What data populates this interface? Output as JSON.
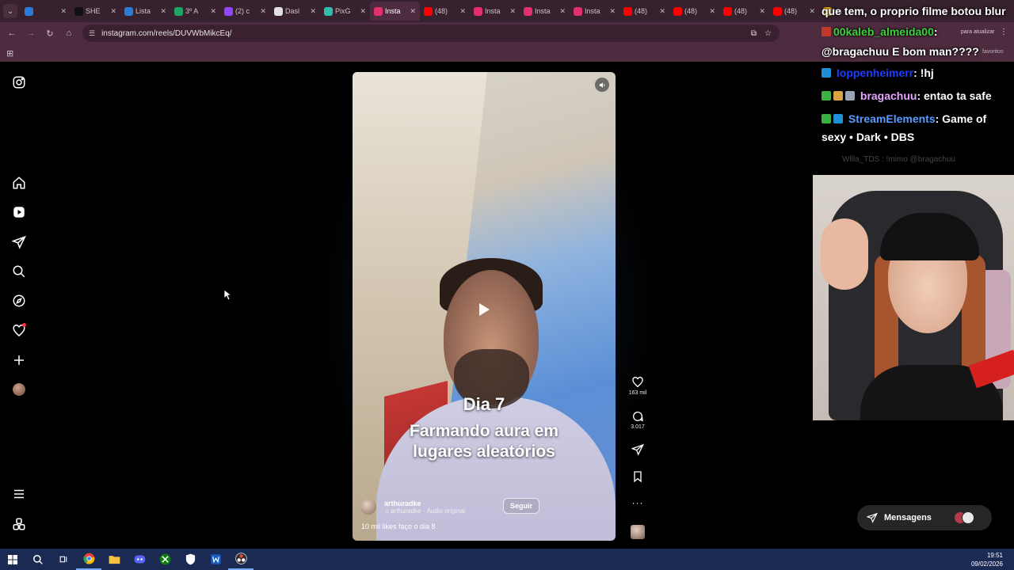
{
  "browser": {
    "tabs": [
      {
        "title": "",
        "icon": "pin-icon",
        "color": "#2b7bd8",
        "active": false
      },
      {
        "title": "SHE",
        "icon": "s-icon",
        "color": "#111111",
        "active": false
      },
      {
        "title": "Lista",
        "icon": "cloud-icon",
        "color": "#2b7bd8",
        "active": false
      },
      {
        "title": "3º A",
        "icon": "drive-icon",
        "color": "#1fa463",
        "active": false
      },
      {
        "title": "(2) c",
        "icon": "twitch-icon",
        "color": "#9146ff",
        "active": false
      },
      {
        "title": "Dasl",
        "icon": "globe-icon",
        "color": "#e0e0e0",
        "active": false
      },
      {
        "title": "PixG",
        "icon": "pix-icon",
        "color": "#32bcad",
        "active": false
      },
      {
        "title": "Insta",
        "icon": "instagram-icon",
        "color": "#e1306c",
        "active": true
      },
      {
        "title": "(48)",
        "icon": "youtube-icon",
        "color": "#ff0000",
        "active": false
      },
      {
        "title": "Insta",
        "icon": "instagram-icon",
        "color": "#e1306c",
        "active": false
      },
      {
        "title": "Insta",
        "icon": "instagram-icon",
        "color": "#e1306c",
        "active": false
      },
      {
        "title": "Insta",
        "icon": "instagram-icon",
        "color": "#e1306c",
        "active": false
      },
      {
        "title": "(48)",
        "icon": "youtube-icon",
        "color": "#ff0000",
        "active": false
      },
      {
        "title": "(48)",
        "icon": "youtube-icon",
        "color": "#ff0000",
        "active": false
      },
      {
        "title": "(48)",
        "icon": "youtube-icon",
        "color": "#ff0000",
        "active": false
      },
      {
        "title": "(48)",
        "icon": "youtube-icon",
        "color": "#ff0000",
        "active": false
      },
      {
        "title": "ca",
        "icon": "face-icon",
        "color": "#f2b600",
        "active": false
      }
    ],
    "url": "instagram.com/reels/DUVWbMikcEq/",
    "update_label": "para atualizar",
    "favorites_label": "favoritos"
  },
  "reel": {
    "caption_line1": "Dia 7",
    "caption_line2": "Farmando aura em",
    "caption_line3": "lugares aleatórios",
    "author": "arthuradke",
    "audio": "arthuradke · Áudio original",
    "follow_label": "Seguir",
    "description": "10 mil likes faço o dia 8",
    "likes": "163 mil",
    "comments": "3.017"
  },
  "chat": {
    "line0": "que tem, o proprio filme botou blur",
    "line1_user": "00kaleb_almeida00",
    "line1_sep": ":",
    "line1_msg": "@bragachuu E bom man????",
    "line2_user": "Ioppenheimerr",
    "line2_msg": ": !hj",
    "line3_user": "bragachuu",
    "line3_msg": ": entao ta safe",
    "line4_user": "StreamElements",
    "line4_msg": ": Game of",
    "line4_cont": "sexy • Dark • DBS",
    "line5_faded": "Willa_TDS : !mimo @bragachuu"
  },
  "messages_label": "Mensagens",
  "clock": {
    "time": "19:51",
    "date": "09/02/2026"
  },
  "colors": {
    "browser_tabbar": "#38212e",
    "browser_toolbar": "#4e2c3f",
    "taskbar": "#1b2a52",
    "notification": "#ff3040"
  }
}
